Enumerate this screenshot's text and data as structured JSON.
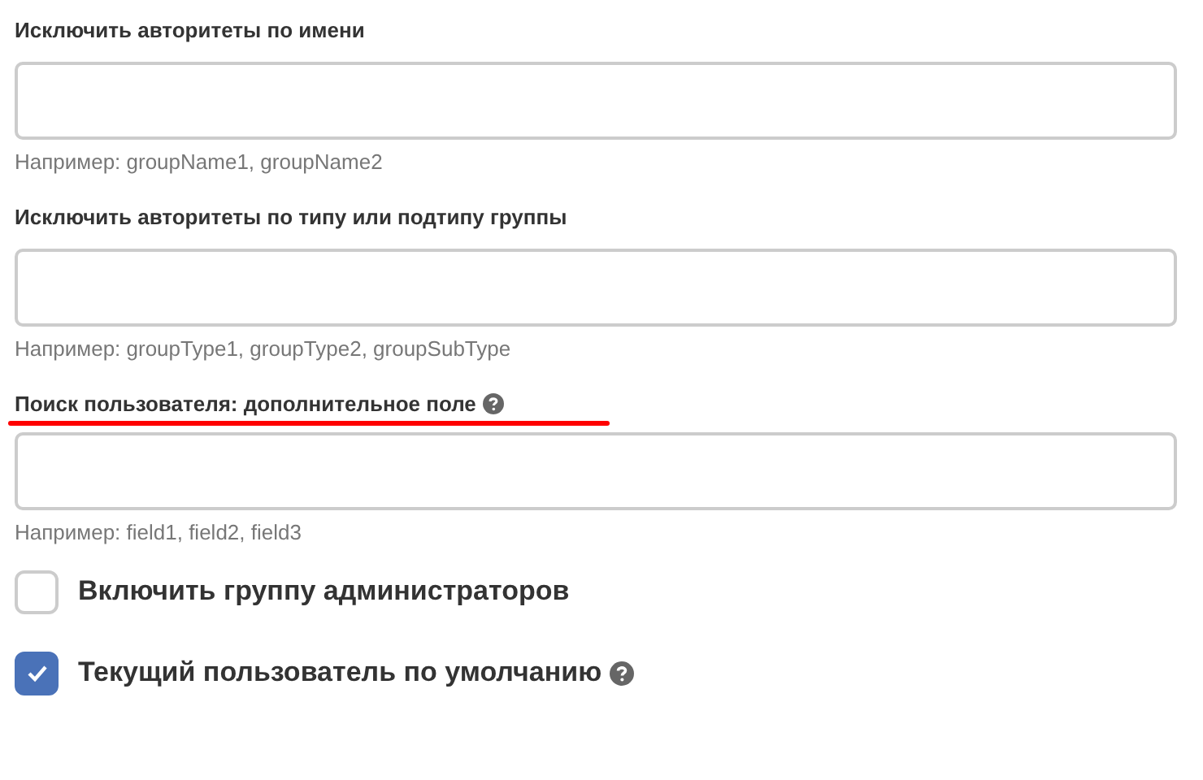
{
  "fields": [
    {
      "label": "Исключить авторитеты по имени",
      "help": false,
      "underlined": false,
      "hint": "Например: groupName1, groupName2"
    },
    {
      "label": "Исключить авторитеты по типу или подтипу группы",
      "help": false,
      "underlined": false,
      "hint": "Например: groupType1, groupType2, groupSubType"
    },
    {
      "label": "Поиск пользователя: дополнительное поле",
      "help": true,
      "underlined": true,
      "hint": "Например: field1, field2, field3"
    }
  ],
  "checkboxes": [
    {
      "label": "Включить группу администраторов",
      "checked": false,
      "help": false
    },
    {
      "label": "Текущий пользователь по умолчанию",
      "checked": true,
      "help": true
    }
  ]
}
